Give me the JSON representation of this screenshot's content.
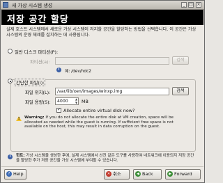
{
  "window": {
    "title": "새 가상 시스템 생성"
  },
  "header": {
    "title": "저장 공간 할당"
  },
  "intro": "실제 호스트 시스템에서 새로운 가상 시스템이 저지할 공간을 할당하는 방법을 선택합니다. 이 공간은 가상 시스템의 운영 체제를 설치하는 데 사용됩니다.",
  "partition": {
    "radio_label": "일반 디스크 파티션(P):",
    "field_label": "파티션(a):",
    "value": "",
    "browse": "검색",
    "example": "예: /dev/hdc2"
  },
  "file": {
    "radio_label": "간단한 파일(i):",
    "location_label": "파일 위치(L):",
    "location_value": "/var/lib/xen/images/winxp.img",
    "browse": "검색",
    "size_label": "파일 용량(S):",
    "size_value": "4000",
    "unit": "MB",
    "allocate_label": "Allocate entire virtual disk now?",
    "warning_title": "Warning:",
    "warning_text": "If you do not allocate the entire disk at VM creation, space will be allocated as needed while the guest is running. If sufficient free space is not available on the host, this may result in data corruption on the guest."
  },
  "tip": {
    "title": "힌트:",
    "text": "가상 시스템을 생성한 후에, 실제 시스템에서 선진 같은 도구를 사용하여 네트워크에 이용되지 저장 공간을 할당한 추가 저장 공간을 가상 시스템에 부여할 수 있습니다."
  },
  "footer": {
    "help": "Help",
    "cancel": "취소",
    "back": "Back",
    "forward": "Forward"
  }
}
